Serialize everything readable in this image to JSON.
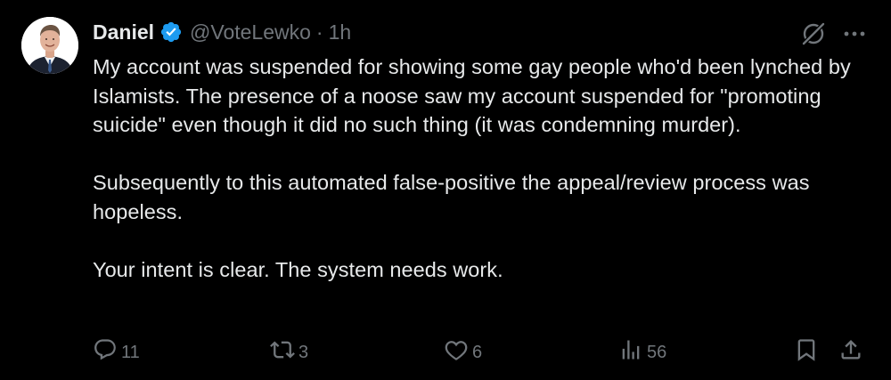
{
  "author": {
    "display_name": "Daniel",
    "handle": "@VoteLewko",
    "separator": "·",
    "time": "1h",
    "verified": true
  },
  "tweet": {
    "paragraphs": [
      "My account was suspended for showing some gay people who'd been lynched by Islamists. The presence of a noose saw my account suspended for \"promoting suicide\" even though it did no such thing (it was condemning murder).",
      "Subsequently to this automated false-positive the appeal/review process was hopeless.",
      "Your intent is clear. The system needs work."
    ]
  },
  "actions": {
    "replies": "11",
    "reposts": "3",
    "likes": "6",
    "views": "56"
  },
  "icons": {
    "verified": "verified-badge-icon",
    "grok": "grok-icon",
    "more": "more-icon",
    "reply": "reply-icon",
    "repost": "repost-icon",
    "like": "heart-icon",
    "views": "views-chart-icon",
    "bookmark": "bookmark-icon",
    "share": "share-icon"
  },
  "colors": {
    "background": "#000000",
    "text": "#e7e9ea",
    "secondary": "#71767b",
    "verified": "#1d9bf0"
  }
}
